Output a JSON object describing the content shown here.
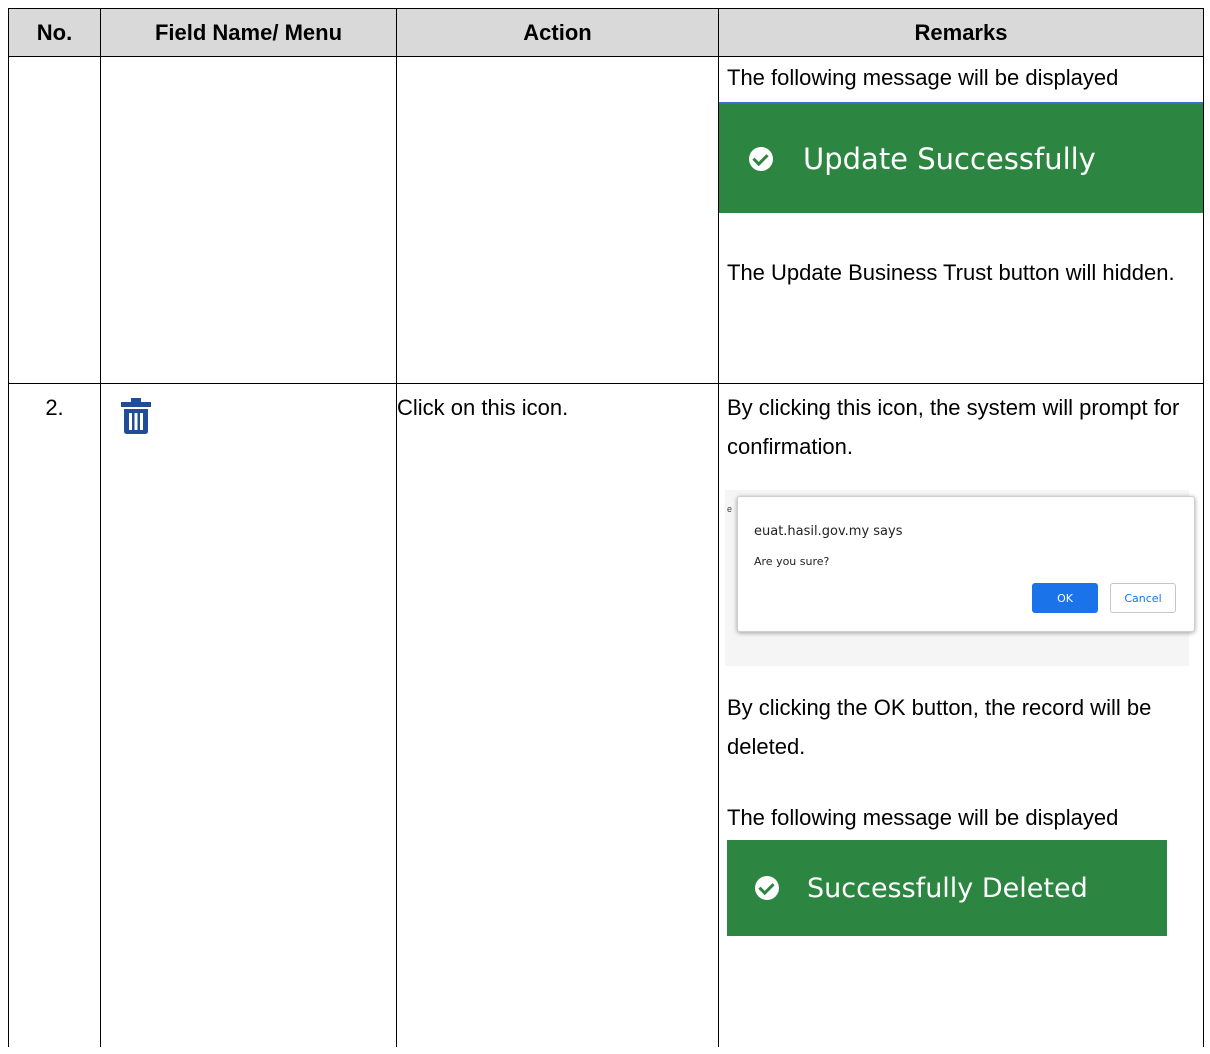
{
  "table": {
    "headers": [
      "No.",
      "Field Name/ Menu",
      "Action",
      "Remarks"
    ],
    "row1": {
      "remarks_intro": "The following message will be displayed",
      "toast_text": "Update Successfully",
      "remarks_after": "The Update Business Trust button will hidden."
    },
    "row2": {
      "no": "2.",
      "icon": "trash-icon",
      "action": "Click on this icon.",
      "remarks_intro": "By clicking this icon, the system will prompt for confirmation.",
      "dialog": {
        "title": "euat.hasil.gov.my says",
        "message": "Are you sure?",
        "ok_label": "OK",
        "cancel_label": "Cancel"
      },
      "remarks_ok": "By clicking the OK button, the record will be deleted.",
      "remarks_toast_intro": "The following message will be displayed",
      "toast_text": "Successfully Deleted"
    }
  },
  "colors": {
    "header_bg": "#d9d9d9",
    "toast_green": "#2c8540",
    "icon_blue": "#1f4e96",
    "ok_blue": "#1a73e8"
  }
}
